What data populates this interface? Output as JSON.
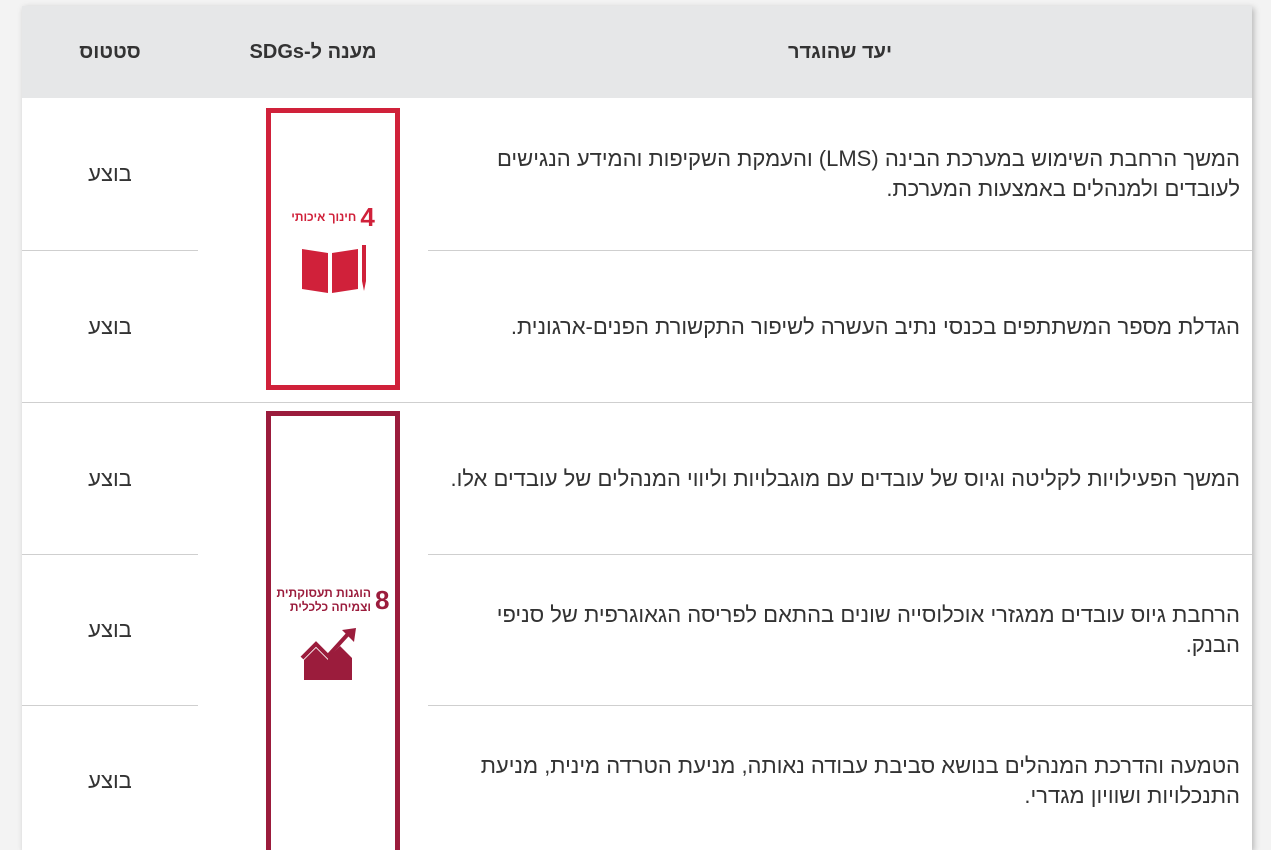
{
  "table": {
    "headers": {
      "goal": "יעד שהוגדר",
      "sdg": "מענה ל-SDGs",
      "status": "סטטוס"
    },
    "rows": [
      {
        "goal": "המשך הרחבת השימוש במערכת הבינה (LMS) והעמקת השקיפות והמידע הנגישים לעובדים ולמנהלים באמצעות המערכת.",
        "status": "בוצע"
      },
      {
        "goal": "הגדלת מספר המשתתפים בכנסי נתיב העשרה לשיפור התקשורת הפנים-ארגונית.",
        "status": "בוצע"
      },
      {
        "goal": "המשך הפעילויות לקליטה וגיוס של עובדים עם מוגבלויות וליווי המנהלים של עובדים אלו.",
        "status": "בוצע"
      },
      {
        "goal": "הרחבת גיוס עובדים ממגזרי אוכלוסייה שונים בהתאם לפריסה הגאוגרפית של סניפי הבנק.",
        "status": "בוצע"
      },
      {
        "goal": "הטמעה והדרכת המנהלים בנושא סביבת עבודה נאותה, מניעת הטרדה מינית, מניעת התנכלויות ושוויון מגדרי.",
        "status": "בוצע"
      }
    ],
    "sdgs": [
      {
        "number": "4",
        "label": "חינוך איכותי",
        "icon": "book-pencil-icon",
        "color": "#d0213a"
      },
      {
        "number": "8",
        "label_line1": "הוגנות תעסוקתית",
        "label_line2": "וצמיחה כלכלית",
        "icon": "growth-chart-icon",
        "color": "#9b1c3c"
      }
    ]
  }
}
